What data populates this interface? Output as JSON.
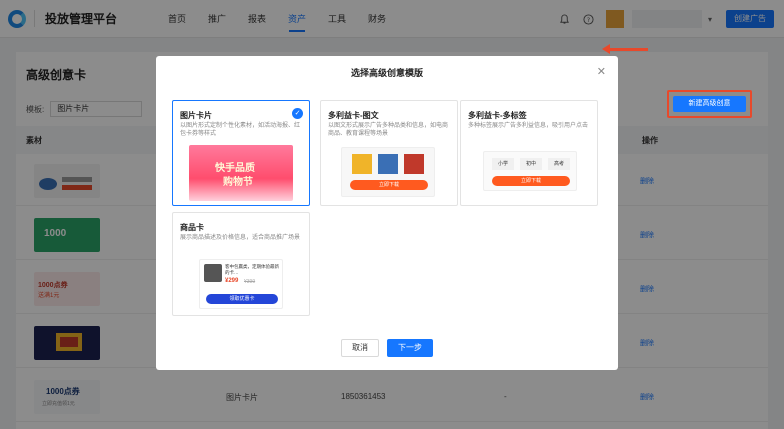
{
  "header": {
    "brand": "投放管理平台",
    "nav": [
      {
        "label": "首页"
      },
      {
        "label": "推广"
      },
      {
        "label": "报表"
      },
      {
        "label": "资产"
      },
      {
        "label": "工具"
      },
      {
        "label": "财务"
      }
    ],
    "active_nav": "资产",
    "create_ad_label": "创建广告"
  },
  "page": {
    "title": "高级创意卡",
    "filter_label": "模板:",
    "filter_value": "图片卡片",
    "new_button": "新建高级创意",
    "columns": {
      "material": "素材",
      "action": "操作"
    },
    "rows": [
      {
        "op": "删除"
      },
      {
        "op": "删除"
      },
      {
        "op": "删除"
      },
      {
        "op": "删除"
      },
      {
        "op": "删除",
        "template": "图片卡片",
        "id": "1850361453",
        "status": "-"
      }
    ],
    "thumb_texts": {
      "r2": "1000",
      "r3a": "1000点券",
      "r3b": "送满1元",
      "r5": "1000点券",
      "r5sub": "立即充值领1元"
    }
  },
  "modal": {
    "title": "选择高级创意模版",
    "cards": [
      {
        "title": "图片卡片",
        "desc": "以图片形式定制个性化素材，如活动海报、红包卡券等样式",
        "selected": true
      },
      {
        "title": "多利益卡-图文",
        "desc": "以图文形式展示广告多种品类和信息，如电商商品、教育课程等场景"
      },
      {
        "title": "多利益卡-多标签",
        "desc": "多种标签展示广告多利益信息，吸引用户点击"
      },
      {
        "title": "商品卡",
        "desc": "展示商品描述及价格信息，适合商品推广场景"
      }
    ],
    "previews": {
      "poster_line1": "快手品质",
      "poster_line2": "购物节",
      "download": "立即下载",
      "tags": [
        "小学",
        "初中",
        "高考"
      ],
      "goods_name": "客中包赢类，定期体验最新的卡…",
      "goods_price": "¥299",
      "goods_old_price": "¥399",
      "goods_btn": "领取优惠卡"
    },
    "cancel": "取消",
    "next": "下一步"
  }
}
